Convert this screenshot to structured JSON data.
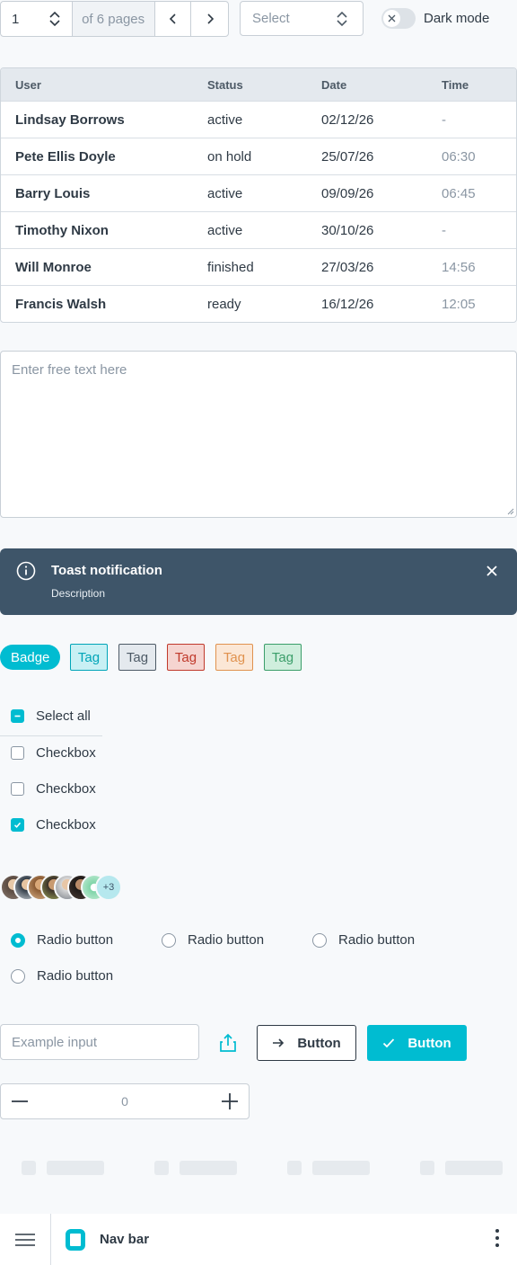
{
  "pagination": {
    "current_page": "1",
    "of_pages_label": "of 6 pages"
  },
  "select": {
    "placeholder": "Select"
  },
  "dark_mode": {
    "label": "Dark mode",
    "enabled": false
  },
  "table": {
    "headers": [
      "User",
      "Status",
      "Date",
      "Time"
    ],
    "rows": [
      {
        "user": "Lindsay Borrows",
        "status": "active",
        "date": "02/12/26",
        "time": "-"
      },
      {
        "user": "Pete Ellis Doyle",
        "status": "on hold",
        "date": "25/07/26",
        "time": "06:30"
      },
      {
        "user": "Barry Louis",
        "status": "active",
        "date": "09/09/26",
        "time": "06:45"
      },
      {
        "user": "Timothy Nixon",
        "status": "active",
        "date": "30/10/26",
        "time": "-"
      },
      {
        "user": "Will Monroe",
        "status": "finished",
        "date": "27/03/26",
        "time": "14:56"
      },
      {
        "user": "Francis Walsh",
        "status": "ready",
        "date": "16/12/26",
        "time": "12:05"
      }
    ]
  },
  "textarea": {
    "placeholder": "Enter free text here"
  },
  "toast": {
    "title": "Toast notification",
    "description": "Description"
  },
  "badge": {
    "label": "Badge"
  },
  "tags": [
    {
      "label": "Tag",
      "color": "#00a5b8",
      "bg": "#c8f0f4"
    },
    {
      "label": "Tag",
      "color": "#4d5a66",
      "bg": "#e4e9ee"
    },
    {
      "label": "Tag",
      "color": "#c0392b",
      "bg": "#f5d4d0"
    },
    {
      "label": "Tag",
      "color": "#e0924f",
      "bg": "#fbe7d6"
    },
    {
      "label": "Tag",
      "color": "#3b9e6a",
      "bg": "#cfeedd"
    }
  ],
  "checkboxes": {
    "select_all": {
      "label": "Select all",
      "state": "indeterminate"
    },
    "items": [
      {
        "label": "Checkbox",
        "checked": false
      },
      {
        "label": "Checkbox",
        "checked": false
      },
      {
        "label": "Checkbox",
        "checked": true
      }
    ]
  },
  "avatars": {
    "more_label": "+3"
  },
  "radios": [
    {
      "label": "Radio button",
      "selected": true
    },
    {
      "label": "Radio button",
      "selected": false
    },
    {
      "label": "Radio button",
      "selected": false
    },
    {
      "label": "Radio button",
      "selected": false
    }
  ],
  "example_input": {
    "placeholder": "Example input"
  },
  "buttons": {
    "secondary_label": "Button",
    "primary_label": "Button"
  },
  "number_stepper": {
    "value": "0"
  },
  "navbar": {
    "title": "Nav bar"
  },
  "colors": {
    "accent": "#00bcd1",
    "toast_bg": "#3e5569"
  }
}
